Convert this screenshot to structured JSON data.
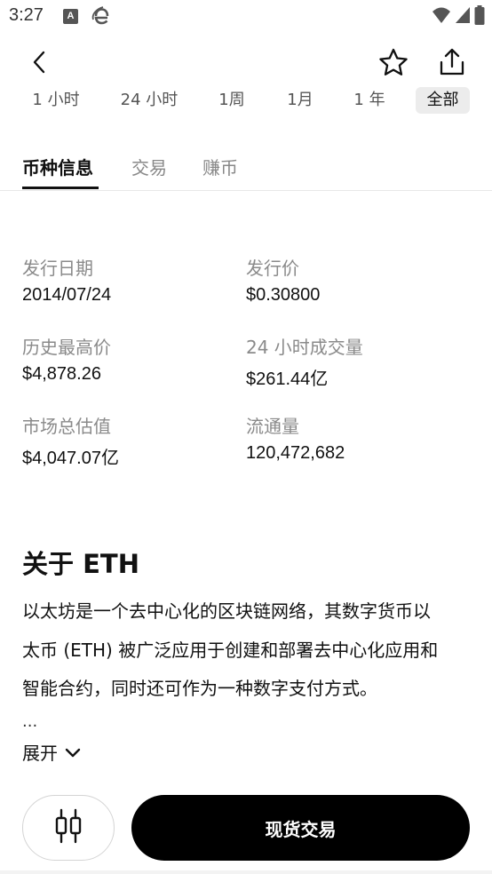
{
  "status_bar": {
    "time": "3:27",
    "icons": [
      "notification-a-icon",
      "browser-e-icon",
      "wifi-icon",
      "signal-icon",
      "battery-icon"
    ]
  },
  "header": {
    "icons": [
      "back-arrow-icon",
      "star-icon",
      "share-icon"
    ]
  },
  "periods": [
    "1 小时",
    "24 小时",
    "1周",
    "1月",
    "1 年",
    "全部"
  ],
  "active_period": "全部",
  "tabs": [
    "币种信息",
    "交易",
    "赚币"
  ],
  "active_tab": "币种信息",
  "stats": {
    "issue_date_label": "发行日期",
    "issue_date_value": "2014/07/24",
    "issue_price_label": "发行价",
    "issue_price_value": "$0.30800",
    "ath_label": "历史最高价",
    "ath_value": "$4,878.26",
    "volume_label": "24 小时成交量",
    "volume_value": "$261.44亿",
    "market_cap_label": "市场总估值",
    "market_cap_value": "$4,047.07亿",
    "supply_label": "流通量",
    "supply_value": "120,472,682"
  },
  "about": {
    "title": "关于 ETH",
    "line1": "以太坊是一个去中心化的区块链网络，其数字货币以",
    "line2": "太币 (ETH) 被广泛应用于创建和部署去中心化应用和",
    "line3": "智能合约，同时还可作为一种数字支付方式。",
    "ellipsis": "...",
    "expand_label": "展开"
  },
  "bottom": {
    "chart_icon": "candlestick-chart-icon",
    "trade_label": "现货交易"
  },
  "colors": {
    "primary_button": "#000000",
    "muted_text": "#8a8a8a",
    "active_period_bg": "#ececec"
  }
}
